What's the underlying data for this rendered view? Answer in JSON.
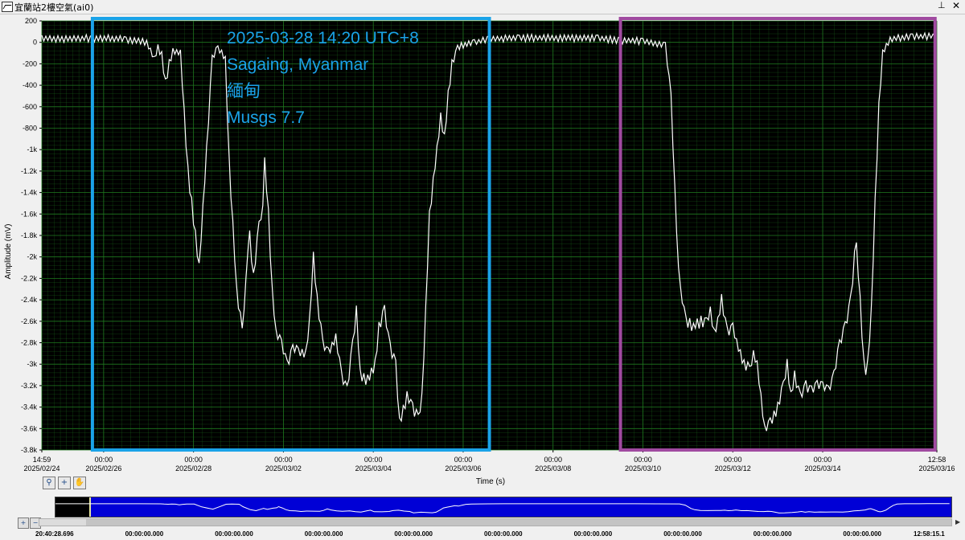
{
  "window": {
    "title": "宜蘭站2樓空氣(ai0)",
    "pin_icon": "pin-icon",
    "close_icon": "close-icon"
  },
  "annotations": [
    "2025-03-28 14:20 UTC+8",
    "Sagaing, Myanmar",
    "緬甸",
    "Musgs 7.7"
  ],
  "colors": {
    "plot_bg": "#000000",
    "grid": "#1f7a1f",
    "trace": "#ffffff",
    "box_left": "#1aa3e8",
    "box_right": "#a04aa0",
    "navigator_bg": "#0000d6"
  },
  "toolbar": {
    "icons": [
      "zoom-icon",
      "cursor-icon",
      "pan-hand-icon"
    ]
  },
  "chart_data": {
    "type": "line",
    "title": "",
    "xlabel": "Time (s)",
    "ylabel": "Amplitude (mV)",
    "x_start": "2025-02-24 14:59",
    "x_end": "2025-03-16 12:58",
    "ylim": [
      -3800,
      200
    ],
    "y_ticks": [
      "200",
      "0",
      "-200",
      "-400",
      "-600",
      "-800",
      "-1k",
      "-1.2k",
      "-1.4k",
      "-1.6k",
      "-1.8k",
      "-2k",
      "-2.2k",
      "-2.4k",
      "-2.6k",
      "-2.8k",
      "-3k",
      "-3.2k",
      "-3.4k",
      "-3.6k",
      "-3.8k"
    ],
    "y_tick_values": [
      200,
      0,
      -200,
      -400,
      -600,
      -800,
      -1000,
      -1200,
      -1400,
      -1600,
      -1800,
      -2000,
      -2200,
      -2400,
      -2600,
      -2800,
      -3000,
      -3200,
      -3400,
      -3600,
      -3800
    ],
    "x_ticks": [
      {
        "x": "2025-02-24 14:59",
        "line1": "14:59",
        "line2": "2025/02/24"
      },
      {
        "x": "2025-02-26 00:00",
        "line1": "00:00",
        "line2": "2025/02/26"
      },
      {
        "x": "2025-02-28 00:00",
        "line1": "00:00",
        "line2": "2025/02/28"
      },
      {
        "x": "2025-03-02 00:00",
        "line1": "00:00",
        "line2": "2025/03/02"
      },
      {
        "x": "2025-03-04 00:00",
        "line1": "00:00",
        "line2": "2025/03/04"
      },
      {
        "x": "2025-03-06 00:00",
        "line1": "00:00",
        "line2": "2025/03/06"
      },
      {
        "x": "2025-03-08 00:00",
        "line1": "00:00",
        "line2": "2025/03/08"
      },
      {
        "x": "2025-03-10 00:00",
        "line1": "00:00",
        "line2": "2025/03/10"
      },
      {
        "x": "2025-03-12 00:00",
        "line1": "00:00",
        "line2": "2025/03/12"
      },
      {
        "x": "2025-03-14 00:00",
        "line1": "00:00",
        "line2": "2025/03/14"
      },
      {
        "x": "2025-03-16 12:58",
        "line1": "12:58",
        "line2": "2025/03/16"
      }
    ],
    "grid": true,
    "series": [
      {
        "points": [
          [
            "2025-02-24 15:00",
            40
          ],
          [
            "2025-02-25 06:00",
            30
          ],
          [
            "2025-02-25 18:00",
            40
          ],
          [
            "2025-02-26 12:00",
            30
          ],
          [
            "2025-02-26 23:00",
            0
          ],
          [
            "2025-02-27 01:00",
            -80
          ],
          [
            "2025-02-27 03:00",
            -150
          ],
          [
            "2025-02-27 05:00",
            -50
          ],
          [
            "2025-02-27 07:00",
            -120
          ],
          [
            "2025-02-27 09:00",
            -380
          ],
          [
            "2025-02-27 11:00",
            -200
          ],
          [
            "2025-02-27 13:00",
            -80
          ],
          [
            "2025-02-27 17:00",
            -100
          ],
          [
            "2025-02-27 21:00",
            -1200
          ],
          [
            "2025-02-28 01:00",
            -1800
          ],
          [
            "2025-02-28 03:00",
            -2100
          ],
          [
            "2025-02-28 07:00",
            -1000
          ],
          [
            "2025-02-28 10:00",
            -150
          ],
          [
            "2025-02-28 13:00",
            -50
          ],
          [
            "2025-02-28 17:00",
            -150
          ],
          [
            "2025-02-28 19:00",
            -1100
          ],
          [
            "2025-02-28 23:00",
            -2300
          ],
          [
            "2025-03-01 02:00",
            -2700
          ],
          [
            "2025-03-01 05:00",
            -2000
          ],
          [
            "2025-03-01 06:00",
            -1800
          ],
          [
            "2025-03-01 08:00",
            -2200
          ],
          [
            "2025-03-01 11:00",
            -1700
          ],
          [
            "2025-03-01 13:00",
            -1550
          ],
          [
            "2025-03-01 14:00",
            -1100
          ],
          [
            "2025-03-01 16:00",
            -1600
          ],
          [
            "2025-03-01 18:00",
            -2300
          ],
          [
            "2025-03-01 20:00",
            -2700
          ],
          [
            "2025-03-01 23:00",
            -2800
          ],
          [
            "2025-03-02 02:00",
            -3000
          ],
          [
            "2025-03-02 05:00",
            -2850
          ],
          [
            "2025-03-02 08:00",
            -2880
          ],
          [
            "2025-03-02 12:00",
            -2900
          ],
          [
            "2025-03-02 14:00",
            -2600
          ],
          [
            "2025-03-02 16:00",
            -2000
          ],
          [
            "2025-03-02 18:00",
            -2400
          ],
          [
            "2025-03-02 21:00",
            -2800
          ],
          [
            "2025-03-03 00:00",
            -2900
          ],
          [
            "2025-03-03 04:00",
            -2750
          ],
          [
            "2025-03-03 07:00",
            -3100
          ],
          [
            "2025-03-03 10:00",
            -3250
          ],
          [
            "2025-03-03 13:00",
            -2800
          ],
          [
            "2025-03-03 15:00",
            -2500
          ],
          [
            "2025-03-03 17:00",
            -3100
          ],
          [
            "2025-03-03 21:00",
            -3150
          ],
          [
            "2025-03-04 01:00",
            -3000
          ],
          [
            "2025-03-04 03:00",
            -2650
          ],
          [
            "2025-03-04 06:00",
            -2500
          ],
          [
            "2025-03-04 09:00",
            -2850
          ],
          [
            "2025-03-04 12:00",
            -3000
          ],
          [
            "2025-03-04 14:00",
            -3550
          ],
          [
            "2025-03-04 18:00",
            -3300
          ],
          [
            "2025-03-04 21:00",
            -3400
          ],
          [
            "2025-03-05 00:00",
            -3500
          ],
          [
            "2025-03-05 02:00",
            -3300
          ],
          [
            "2025-03-05 04:00",
            -2500
          ],
          [
            "2025-03-05 06:00",
            -1600
          ],
          [
            "2025-03-05 08:00",
            -1300
          ],
          [
            "2025-03-05 10:00",
            -1000
          ],
          [
            "2025-03-05 12:00",
            -700
          ],
          [
            "2025-03-05 14:00",
            -900
          ],
          [
            "2025-03-05 16:00",
            -500
          ],
          [
            "2025-03-05 18:00",
            -200
          ],
          [
            "2025-03-05 21:00",
            -50
          ],
          [
            "2025-03-06 01:00",
            -20
          ],
          [
            "2025-03-06 06:00",
            0
          ],
          [
            "2025-03-06 14:00",
            30
          ],
          [
            "2025-03-07 06:00",
            40
          ],
          [
            "2025-03-08 06:00",
            40
          ],
          [
            "2025-03-09 00:00",
            40
          ],
          [
            "2025-03-09 12:00",
            20
          ],
          [
            "2025-03-10 00:00",
            10
          ],
          [
            "2025-03-10 12:00",
            -30
          ],
          [
            "2025-03-10 15:00",
            -500
          ],
          [
            "2025-03-10 18:00",
            -1800
          ],
          [
            "2025-03-10 20:00",
            -2300
          ],
          [
            "2025-03-10 23:00",
            -2600
          ],
          [
            "2025-03-11 03:00",
            -2650
          ],
          [
            "2025-03-11 07:00",
            -2600
          ],
          [
            "2025-03-11 10:00",
            -2620
          ],
          [
            "2025-03-11 12:00",
            -2500
          ],
          [
            "2025-03-11 14:00",
            -2700
          ],
          [
            "2025-03-11 16:00",
            -2600
          ],
          [
            "2025-03-11 18:00",
            -2400
          ],
          [
            "2025-03-11 21:00",
            -2700
          ],
          [
            "2025-03-12 00:00",
            -2650
          ],
          [
            "2025-03-12 02:00",
            -2800
          ],
          [
            "2025-03-12 06:00",
            -3000
          ],
          [
            "2025-03-12 09:00",
            -3050
          ],
          [
            "2025-03-12 11:00",
            -2900
          ],
          [
            "2025-03-12 13:00",
            -3000
          ],
          [
            "2025-03-12 15:00",
            -3300
          ],
          [
            "2025-03-12 17:00",
            -3600
          ],
          [
            "2025-03-12 20:00",
            -3550
          ],
          [
            "2025-03-13 00:00",
            -3400
          ],
          [
            "2025-03-13 03:00",
            -3200
          ],
          [
            "2025-03-13 05:00",
            -3000
          ],
          [
            "2025-03-13 07:00",
            -3300
          ],
          [
            "2025-03-13 09:00",
            -3100
          ],
          [
            "2025-03-13 12:00",
            -3300
          ],
          [
            "2025-03-13 15:00",
            -3200
          ],
          [
            "2025-03-13 18:00",
            -3250
          ],
          [
            "2025-03-13 21:00",
            -3200
          ],
          [
            "2025-03-14 00:00",
            -3200
          ],
          [
            "2025-03-14 03:00",
            -3250
          ],
          [
            "2025-03-14 06:00",
            -3100
          ],
          [
            "2025-03-14 09:00",
            -2800
          ],
          [
            "2025-03-14 12:00",
            -2650
          ],
          [
            "2025-03-14 15:00",
            -2400
          ],
          [
            "2025-03-14 17:00",
            -2000
          ],
          [
            "2025-03-14 18:00",
            -1900
          ],
          [
            "2025-03-14 20:00",
            -2400
          ],
          [
            "2025-03-14 22:00",
            -3000
          ],
          [
            "2025-03-14 23:00",
            -3150
          ],
          [
            "2025-03-15 00:00",
            -3000
          ],
          [
            "2025-03-15 02:00",
            -2500
          ],
          [
            "2025-03-15 04:00",
            -1500
          ],
          [
            "2025-03-15 06:00",
            -600
          ],
          [
            "2025-03-15 08:00",
            -100
          ],
          [
            "2025-03-15 12:00",
            30
          ],
          [
            "2025-03-16 00:00",
            50
          ],
          [
            "2025-03-16 12:00",
            60
          ]
        ]
      }
    ],
    "highlight_boxes": [
      {
        "from": "2025-02-25 18:00",
        "to": "2025-03-06 14:00",
        "color": "#1aa3e8"
      },
      {
        "from": "2025-03-09 12:00",
        "to": "2025-03-16 12:00",
        "color": "#a04aa0"
      }
    ]
  },
  "navigator": {
    "tick_labels": [
      "20:40:28.696",
      "00:00:00.000",
      "00:00:00.000",
      "00:00:00.000",
      "00:00:00.000",
      "00:00:00.000",
      "00:00:00.000",
      "00:00:00.000",
      "00:00:00.000",
      "00:00:00.000",
      "12:58:15.1"
    ]
  }
}
